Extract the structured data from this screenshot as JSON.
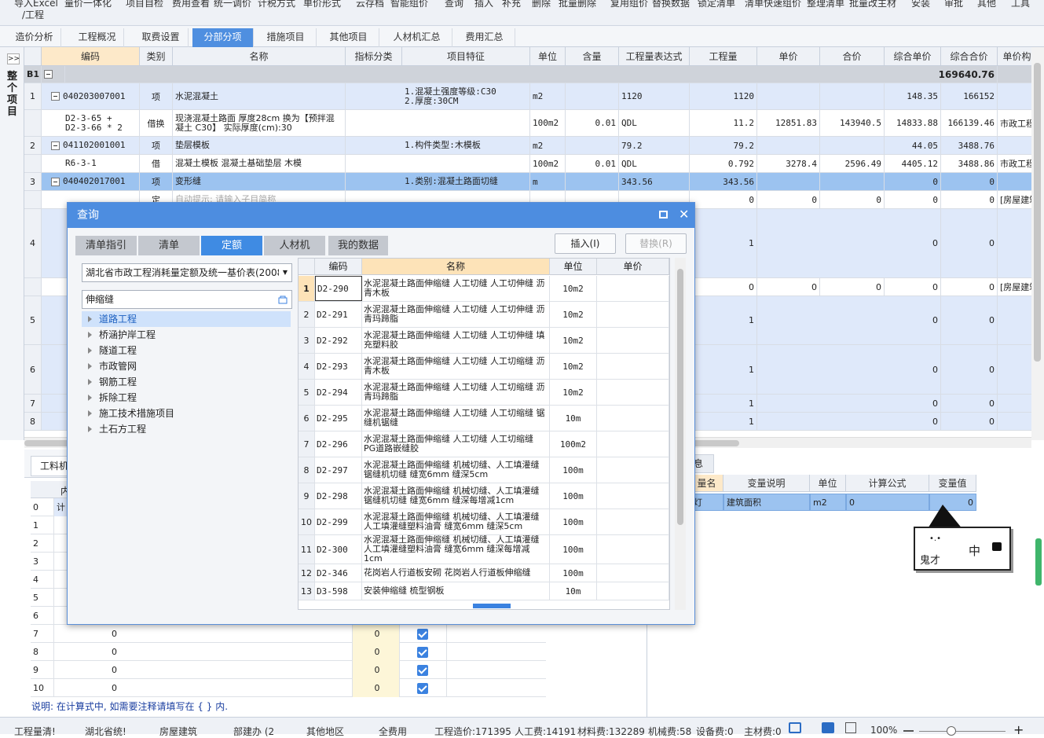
{
  "toolbar": {
    "items_top": [
      "导入Excel",
      "量价一体化",
      "项目自检",
      "费用查看",
      "统一调价",
      "计税方式",
      "单价形式",
      "云存档",
      "智能组价",
      "查询",
      "插入",
      "补充",
      "删除",
      "批量删除",
      "复用组价",
      "替换数据",
      "锁定清单",
      "清单快速组价",
      "整理清单",
      "批量改主材",
      "安装",
      "审批",
      "其他",
      "工具"
    ],
    "item_second": "/工程"
  },
  "tabs": [
    "造价分析",
    "工程概况",
    "取费设置",
    "分部分项",
    "措施项目",
    "其他项目",
    "人材机汇总",
    "费用汇总"
  ],
  "active_tab": "分部分项",
  "left_label": "整个项目",
  "grid": {
    "headers": [
      "编码",
      "类别",
      "名称",
      "指标分类",
      "项目特征",
      "单位",
      "含量",
      "工程量表达式",
      "工程量",
      "单价",
      "合价",
      "综合单价",
      "综合合价",
      "单价构"
    ],
    "b1": {
      "label": "B1",
      "total": "169640.76"
    },
    "rows": [
      {
        "num": "1",
        "code": "040203007001",
        "type": "项",
        "name": "水泥混凝土",
        "feature": "1.混凝土强度等级:C30\n2.厚度:30CM",
        "unit": "m2",
        "content": "",
        "expr": "1120",
        "qty": "1120",
        "price": "",
        "amount": "",
        "uprice": "148.35",
        "total": "166152",
        "extra": ""
      },
      {
        "num": "",
        "code": "D2-3-65 +\nD2-3-66 * 2",
        "type": "借换",
        "name": "现浇混凝土路面 厚度28cm 换为【预拌混凝土 C30】 实际厚度(cm):30",
        "feature": "",
        "unit": "100m2",
        "content": "0.01",
        "expr": "QDL",
        "qty": "11.2",
        "price": "12851.83",
        "amount": "143940.5",
        "uprice": "14833.88",
        "total": "166139.46",
        "extra": "市政工程"
      },
      {
        "num": "2",
        "code": "041102001001",
        "type": "项",
        "name": "垫层模板",
        "feature": "1.构件类型:木模板",
        "unit": "m2",
        "content": "",
        "expr": "79.2",
        "qty": "79.2",
        "price": "",
        "amount": "",
        "uprice": "44.05",
        "total": "3488.76",
        "extra": ""
      },
      {
        "num": "",
        "code": "R6-3-1",
        "type": "借",
        "name": "混凝土模板 混凝土基础垫层 木模",
        "feature": "",
        "unit": "100m2",
        "content": "0.01",
        "expr": "QDL",
        "qty": "0.792",
        "price": "3278.4",
        "amount": "2596.49",
        "uprice": "4405.12",
        "total": "3488.86",
        "extra": "市政工程"
      },
      {
        "num": "3",
        "code": "040402017001",
        "type": "项",
        "name": "变形缝",
        "feature": "1.类别:混凝土路面切缝",
        "unit": "m",
        "content": "",
        "expr": "343.56",
        "qty": "343.56",
        "price": "",
        "amount": "",
        "uprice": "0",
        "total": "0",
        "extra": ""
      },
      {
        "num": "",
        "code": "",
        "type": "定",
        "name": "自动提示: 请输入子目简称",
        "feature": "",
        "unit": "",
        "content": "",
        "expr": "",
        "qty": "0",
        "price": "0",
        "amount": "0",
        "uprice": "0",
        "total": "0",
        "extra": "[房屋建筑"
      }
    ],
    "lower_rows": [
      {
        "num": "4",
        "qty": "1",
        "uprice": "0",
        "total": "0"
      },
      {
        "num": "",
        "qty": "0",
        "price": "0",
        "amount": "0",
        "uprice": "0",
        "total": "0",
        "extra": "[房屋建筑"
      },
      {
        "num": "5",
        "qty": "1",
        "uprice": "0",
        "total": "0"
      },
      {
        "num": "6",
        "qty": "1",
        "uprice": "0",
        "total": "0"
      },
      {
        "num": "7",
        "qty": "1",
        "uprice": "0",
        "total": "0"
      },
      {
        "num": "8",
        "qty": "1",
        "uprice": "0",
        "total": "0"
      }
    ]
  },
  "bottom": {
    "tab_label": "工料机",
    "info_tab": "息",
    "list_header": "内",
    "row0_label": "计",
    "rows": [
      {
        "n": "0"
      },
      {
        "n": "1"
      },
      {
        "n": "2"
      },
      {
        "n": "3"
      },
      {
        "n": "4"
      },
      {
        "n": "5"
      },
      {
        "n": "6"
      },
      {
        "n": "7",
        "v": "0",
        "q": "0"
      },
      {
        "n": "8",
        "v": "0",
        "q": "0"
      },
      {
        "n": "9",
        "v": "0",
        "q": "0"
      },
      {
        "n": "10",
        "v": "0",
        "q": "0"
      }
    ],
    "note": "说明: 在计算式中, 如需要注释请填写在 { } 内.",
    "var_table": {
      "headers": [
        "量名",
        "变量说明",
        "单位",
        "计算公式",
        "变量值"
      ],
      "row": {
        "name": "灯",
        "desc": "建筑面积",
        "unit": "m2",
        "formula": "0",
        "value": "0"
      }
    }
  },
  "dialog": {
    "title": "查询",
    "tabs": [
      "清单指引",
      "清单",
      "定额",
      "人材机",
      "我的数据"
    ],
    "active_tab": "定额",
    "insert_btn": "插入(I)",
    "replace_btn": "替换(R)",
    "combo": "湖北省市政工程消耗量定额及统一基价表(2008)",
    "search": "伸缩缝",
    "tree": [
      "道路工程",
      "桥涵护岸工程",
      "隧道工程",
      "市政管网",
      "钢筋工程",
      "拆除工程",
      "施工技术措施项目",
      "土石方工程"
    ],
    "table_headers": [
      "编码",
      "名称",
      "单位",
      "单价"
    ],
    "rows": [
      {
        "n": "1",
        "code": "D2-290",
        "name": "水泥混凝土路面伸缩缝 人工切缝 人工切伸缝 沥青木板",
        "unit": "10m2"
      },
      {
        "n": "2",
        "code": "D2-291",
        "name": "水泥混凝土路面伸缩缝 人工切缝 人工切伸缝 沥青玛蹄脂",
        "unit": "10m2"
      },
      {
        "n": "3",
        "code": "D2-292",
        "name": "水泥混凝土路面伸缩缝 人工切缝 人工切伸缝 填充塑料胶",
        "unit": "10m2"
      },
      {
        "n": "4",
        "code": "D2-293",
        "name": "水泥混凝土路面伸缩缝 人工切缝 人工切缩缝 沥青木板",
        "unit": "10m2"
      },
      {
        "n": "5",
        "code": "D2-294",
        "name": "水泥混凝土路面伸缩缝 人工切缝 人工切缩缝 沥青玛蹄脂",
        "unit": "10m2"
      },
      {
        "n": "6",
        "code": "D2-295",
        "name": "水泥混凝土路面伸缩缝 人工切缝 人工切缩缝 锯缝机锯缝",
        "unit": "10m"
      },
      {
        "n": "7",
        "code": "D2-296",
        "name": "水泥混凝土路面伸缩缝 人工切缝 人工切缩缝 PG道路嵌缝胶",
        "unit": "100m2"
      },
      {
        "n": "8",
        "code": "D2-297",
        "name": "水泥混凝土路面伸缩缝 机械切缝、人工填灌缝 锯缝机切缝 缝宽6mm 缝深5cm",
        "unit": "100m"
      },
      {
        "n": "9",
        "code": "D2-298",
        "name": "水泥混凝土路面伸缩缝 机械切缝、人工填灌缝 锯缝机切缝 缝宽6mm 缝深每增减1cm",
        "unit": "100m"
      },
      {
        "n": "10",
        "code": "D2-299",
        "name": "水泥混凝土路面伸缩缝 机械切缝、人工填灌缝 人工填灌缝塑料油膏 缝宽6mm 缝深5cm",
        "unit": "100m"
      },
      {
        "n": "11",
        "code": "D2-300",
        "name": "水泥混凝土路面伸缩缝 机械切缝、人工填灌缝 人工填灌缝塑料油膏 缝宽6mm 缝深每增减1cm",
        "unit": "100m"
      },
      {
        "n": "12",
        "code": "D2-346",
        "name": "花岗岩人行道板安砌 花岗岩人行道板伸缩缝",
        "unit": "100m"
      },
      {
        "n": "13",
        "code": "D3-598",
        "name": "安装伸缩缝 梳型钢板",
        "unit": "10m"
      }
    ]
  },
  "status": {
    "items": [
      "工程量清!",
      "湖北省统!",
      "房屋建筑",
      "部建办 (2",
      "其他地区",
      "全费用",
      "工程造价:171395",
      "人工费:14191",
      "材料费:132289",
      "机械费:58",
      "设备费:0",
      "主材费:0"
    ],
    "zoom": "100%"
  },
  "sticker": {
    "text_ime": "中",
    "text_name": "鬼才"
  },
  "colors": {
    "accent": "#4d8de0",
    "selected_row": "#9cc3f0",
    "row_blue": "#dfe9fa",
    "header_orange": "#fde9c9"
  }
}
